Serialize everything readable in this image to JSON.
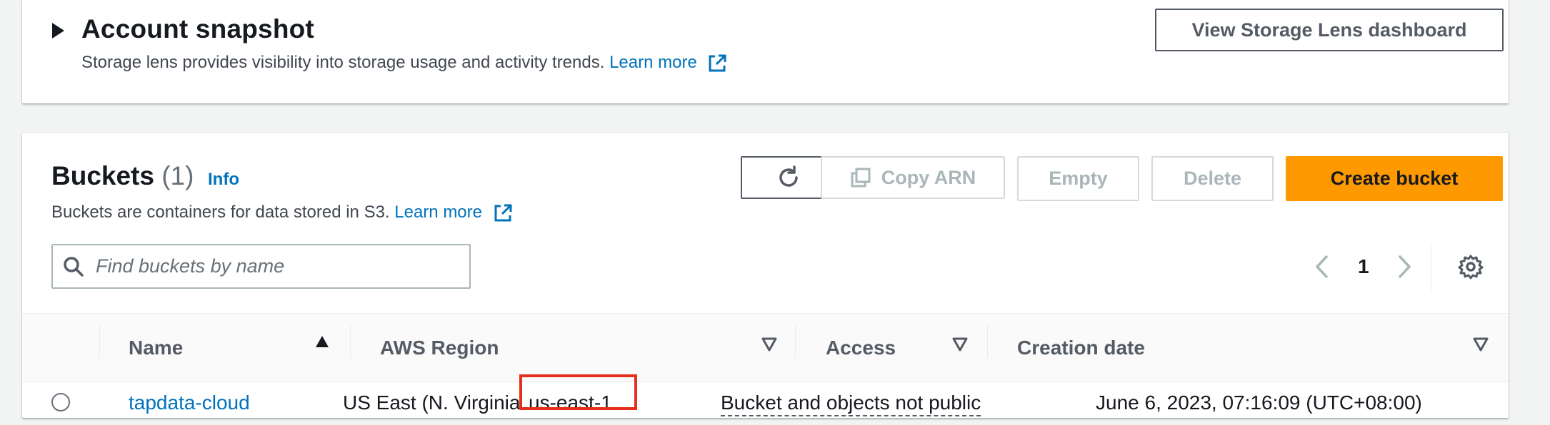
{
  "snapshot": {
    "title": "Account snapshot",
    "description": "Storage lens provides visibility into storage usage and activity trends.",
    "learn_more": "Learn more",
    "view_button": "View Storage Lens dashboard"
  },
  "buckets": {
    "title": "Buckets",
    "count": "(1)",
    "info": "Info",
    "description": "Buckets are containers for data stored in S3.",
    "learn_more": "Learn more",
    "actions": {
      "copy_arn": "Copy ARN",
      "empty": "Empty",
      "delete": "Delete",
      "create": "Create bucket"
    },
    "search": {
      "placeholder": "Find buckets by name",
      "value": ""
    },
    "pagination": {
      "current_page": "1"
    },
    "columns": [
      "Name",
      "AWS Region",
      "Access",
      "Creation date"
    ],
    "rows": [
      {
        "name": "tapdata-cloud",
        "region_label": "US East (N. Virginia",
        "region_code": "us-east-1",
        "access": "Bucket and objects not public",
        "created": "June 6, 2023, 07:16:09 (UTC+08:00)"
      }
    ]
  },
  "colors": {
    "link": "#0073bb",
    "primary": "#ff9900",
    "highlight": "#e52e1c"
  },
  "icons": {
    "caret": "caret-right-icon",
    "external": "external-link-icon",
    "refresh": "refresh-icon",
    "copy": "copy-icon",
    "search": "search-icon",
    "prev": "chevron-left-icon",
    "next": "chevron-right-icon",
    "settings": "gear-icon",
    "sort_asc": "sort-ascending-icon",
    "sort": "sort-icon"
  }
}
